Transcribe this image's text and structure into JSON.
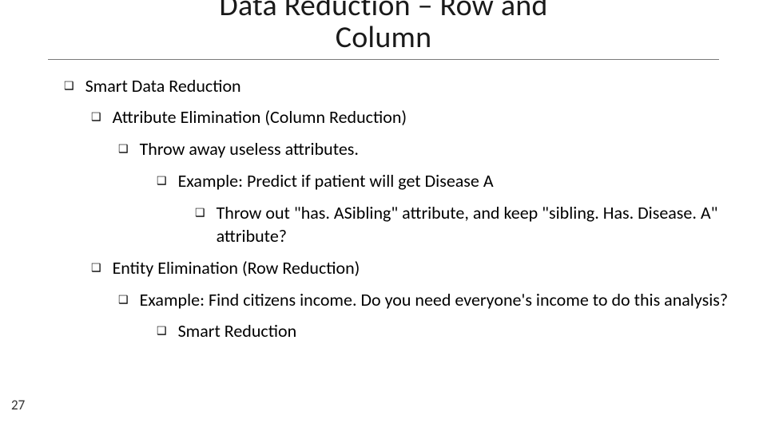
{
  "title_line1": "Data Reduction – Row and",
  "title_line2": "Column",
  "bullet_glyph": "❑",
  "bullets": {
    "b0": "Smart Data Reduction",
    "b1": "Attribute Elimination (Column Reduction)",
    "b2": "Throw away useless attributes.",
    "b3": "Example: Predict if patient will get Disease A",
    "b4": "Throw out \"has. ASibling\" attribute, and keep \"sibling. Has. Disease. A\" attribute?",
    "b5": "Entity Elimination (Row Reduction)",
    "b6": "Example: Find citizens income.  Do you need everyone's income to do this analysis?",
    "b7": "Smart Reduction"
  },
  "page_number": "27"
}
